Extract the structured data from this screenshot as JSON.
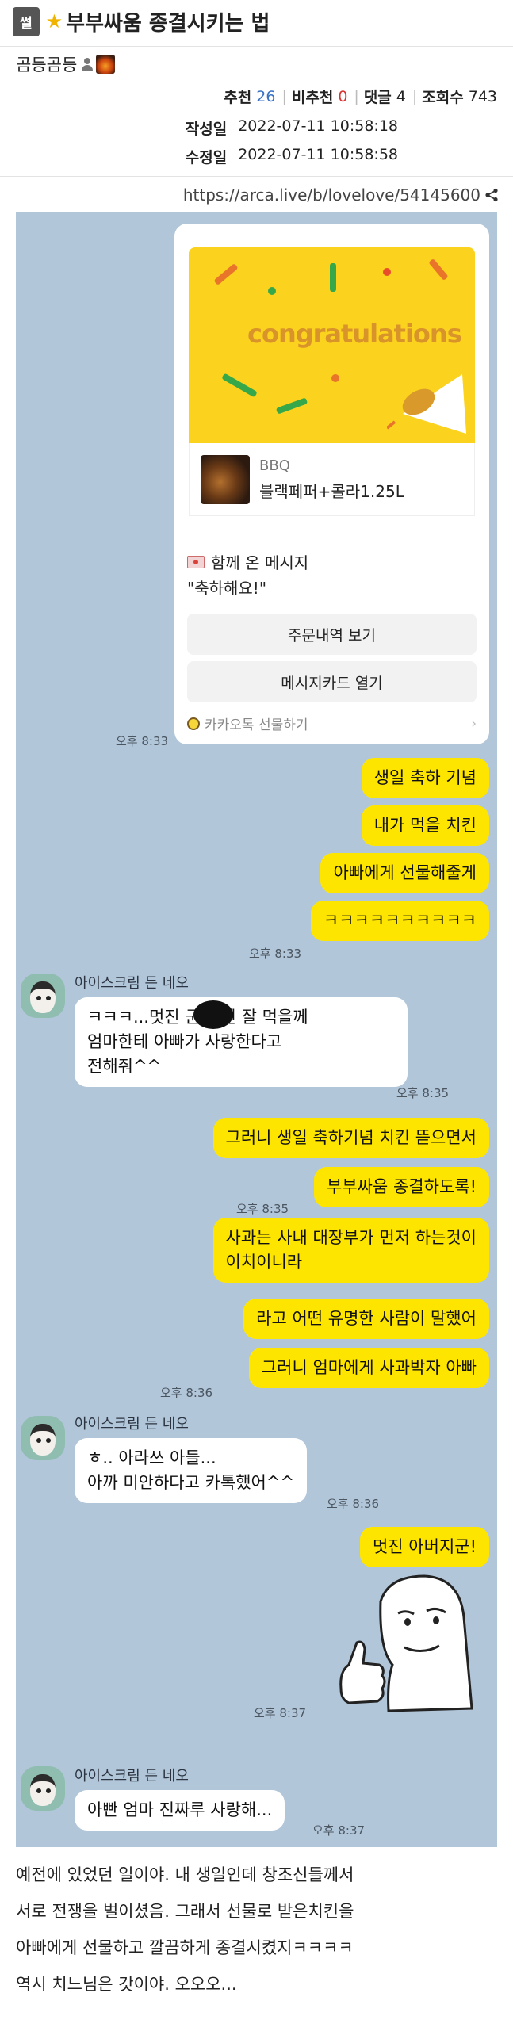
{
  "header": {
    "category": "썰",
    "title": "부부싸움 종결시키는 법",
    "author": "곰등곰등",
    "stats": [
      {
        "label": "추천",
        "value": "26"
      },
      {
        "label": "비추천",
        "value": "0"
      },
      {
        "label": "댓글",
        "value": "4"
      },
      {
        "label": "조회수",
        "value": "743"
      }
    ],
    "created_label": "작성일",
    "created": "2022-07-11 10:58:18",
    "modified_label": "수정일",
    "modified": "2022-07-11 10:58:58",
    "url": "https://arca.live/b/lovelove/54145600"
  },
  "gift": {
    "banner": "congratulations",
    "brand": "BBQ",
    "product": "블랙페퍼+콜라1.25L",
    "message_title": "함께 온 메시지",
    "message": "\"축하해요!\"",
    "button_order": "주문내역 보기",
    "button_card": "메시지카드 열기",
    "footer": "카카오톡 선물하기",
    "time": "오후 8:33"
  },
  "sender_name": "아이스크림 든 네오",
  "messages": {
    "m1": "생일 축하 기념",
    "m2": "내가 먹을 치킨",
    "m3": "아빠에게 선물해줄게",
    "m4": "ㅋㅋㅋㅋㅋㅋㅋㅋㅋㅋ",
    "t1": "오후 8:33",
    "r1_a": "ㅋㅋㅋ...멋진",
    "r1_b": "군 치킨 잘 먹을께",
    "r1_c": "엄마한테 아빠가 사랑한다고\n전해줘^^",
    "t2": "오후 8:35",
    "m5": "그러니 생일 축하기념 치킨 뜯으면서",
    "m6": "부부싸움 종결하도록!",
    "t3": "오후 8:35",
    "m7": "사과는 사내 대장부가 먼저 하는것이\n이치이니라",
    "m8": "라고 어떤 유명한 사람이 말했어",
    "m9": "그러니 엄마에게 사과박자 아빠",
    "t4": "오후 8:36",
    "r2": "ㅎ.. 아라쓰 아들...\n아까 미안하다고 카톡했어^^",
    "t5": "오후 8:36",
    "m10": "멋진 아버지군!",
    "t6": "오후 8:37",
    "r3": "아빤 엄마 진짜루 사랑해...",
    "t7": "오후 8:37"
  },
  "body": [
    "예전에 있었던 일이야. 내 생일인데 창조신들께서",
    "서로 전쟁을 벌이셨음. 그래서 선물로 받은치킨을",
    "아빠에게 선물하고 깔끔하게 종결시켰지ㅋㅋㅋㅋ",
    "역시 치느님은 갓이야. 오오오..."
  ]
}
